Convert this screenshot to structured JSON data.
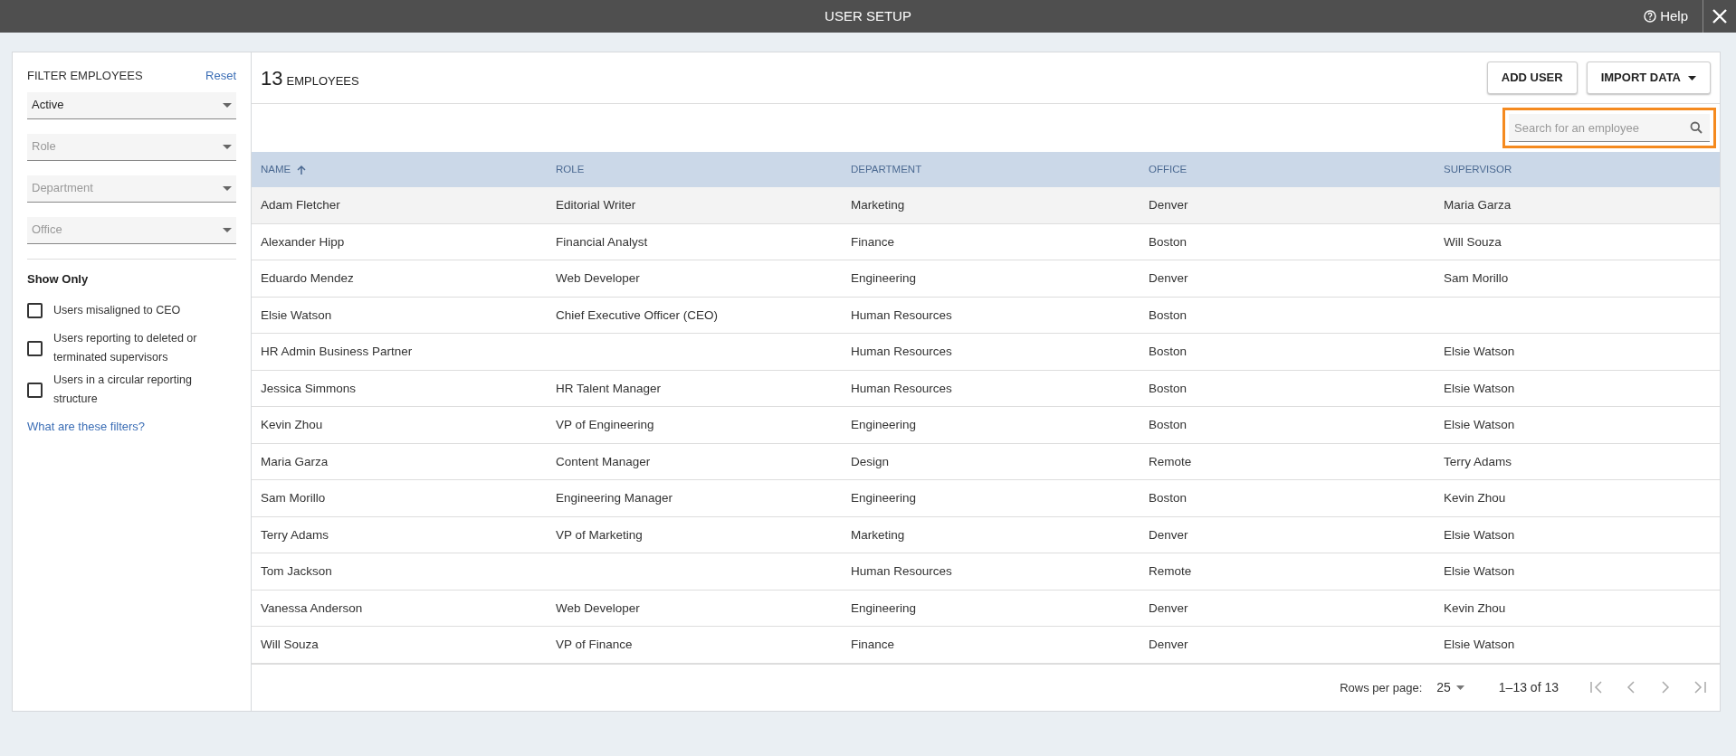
{
  "window": {
    "title": "USER SETUP",
    "help": "Help"
  },
  "filters": {
    "title": "FILTER EMPLOYEES",
    "reset": "Reset",
    "selects": [
      {
        "value": "Active"
      },
      {
        "placeholder": "Role"
      },
      {
        "placeholder": "Department"
      },
      {
        "placeholder": "Office"
      }
    ],
    "show_only": {
      "title": "Show Only",
      "options": [
        {
          "label": "Users misaligned to CEO",
          "checked": false
        },
        {
          "label": "Users reporting to deleted or terminated supervisors",
          "checked": false
        },
        {
          "label": "Users in a circular reporting structure",
          "checked": false
        }
      ]
    },
    "help_link": "What are these filters?"
  },
  "header": {
    "count": "13",
    "count_label": "EMPLOYEES",
    "buttons": [
      {
        "label": "ADD USER",
        "dropdown": false
      },
      {
        "label": "IMPORT DATA",
        "dropdown": true
      }
    ]
  },
  "search": {
    "placeholder": "Search for an employee",
    "focused": true
  },
  "table": {
    "columns": [
      {
        "label": "NAME",
        "sorted": true
      },
      {
        "label": "ROLE",
        "sorted": false
      },
      {
        "label": "DEPARTMENT",
        "sorted": false
      },
      {
        "label": "OFFICE",
        "sorted": false
      },
      {
        "label": "SUPERVISOR",
        "sorted": false
      }
    ],
    "rows": [
      {
        "selected": true,
        "cells": [
          "Adam Fletcher",
          "Editorial Writer",
          "Marketing",
          "Denver",
          "Maria Garza"
        ]
      },
      {
        "selected": false,
        "cells": [
          "Alexander Hipp",
          "Financial Analyst",
          "Finance",
          "Boston",
          "Will Souza"
        ]
      },
      {
        "selected": false,
        "cells": [
          "Eduardo Mendez",
          "Web Developer",
          "Engineering",
          "Denver",
          "Sam Morillo"
        ]
      },
      {
        "selected": false,
        "cells": [
          "Elsie Watson",
          "Chief Executive Officer (CEO)",
          "Human Resources",
          "Boston",
          ""
        ]
      },
      {
        "selected": false,
        "cells": [
          "HR Admin Business Partner",
          "",
          "Human Resources",
          "Boston",
          "Elsie Watson"
        ]
      },
      {
        "selected": false,
        "cells": [
          "Jessica Simmons",
          "HR Talent Manager",
          "Human Resources",
          "Boston",
          "Elsie Watson"
        ]
      },
      {
        "selected": false,
        "cells": [
          "Kevin Zhou",
          "VP of Engineering",
          "Engineering",
          "Boston",
          "Elsie Watson"
        ]
      },
      {
        "selected": false,
        "cells": [
          "Maria Garza",
          "Content Manager",
          "Design",
          "Remote",
          "Terry Adams"
        ]
      },
      {
        "selected": false,
        "cells": [
          "Sam Morillo",
          "Engineering Manager",
          "Engineering",
          "Boston",
          "Kevin Zhou"
        ]
      },
      {
        "selected": false,
        "cells": [
          "Terry Adams",
          "VP of Marketing",
          "Marketing",
          "Denver",
          "Elsie Watson"
        ]
      },
      {
        "selected": false,
        "cells": [
          "Tom Jackson",
          "",
          "Human Resources",
          "Remote",
          "Elsie Watson"
        ]
      },
      {
        "selected": false,
        "cells": [
          "Vanessa Anderson",
          "Web Developer",
          "Engineering",
          "Denver",
          "Kevin Zhou"
        ]
      },
      {
        "selected": false,
        "cells": [
          "Will Souza",
          "VP of Finance",
          "Finance",
          "Denver",
          "Elsie Watson"
        ]
      }
    ]
  },
  "pagination": {
    "rows_label": "Rows per page:",
    "rows_value": "25",
    "range": "1–13 of 13"
  }
}
